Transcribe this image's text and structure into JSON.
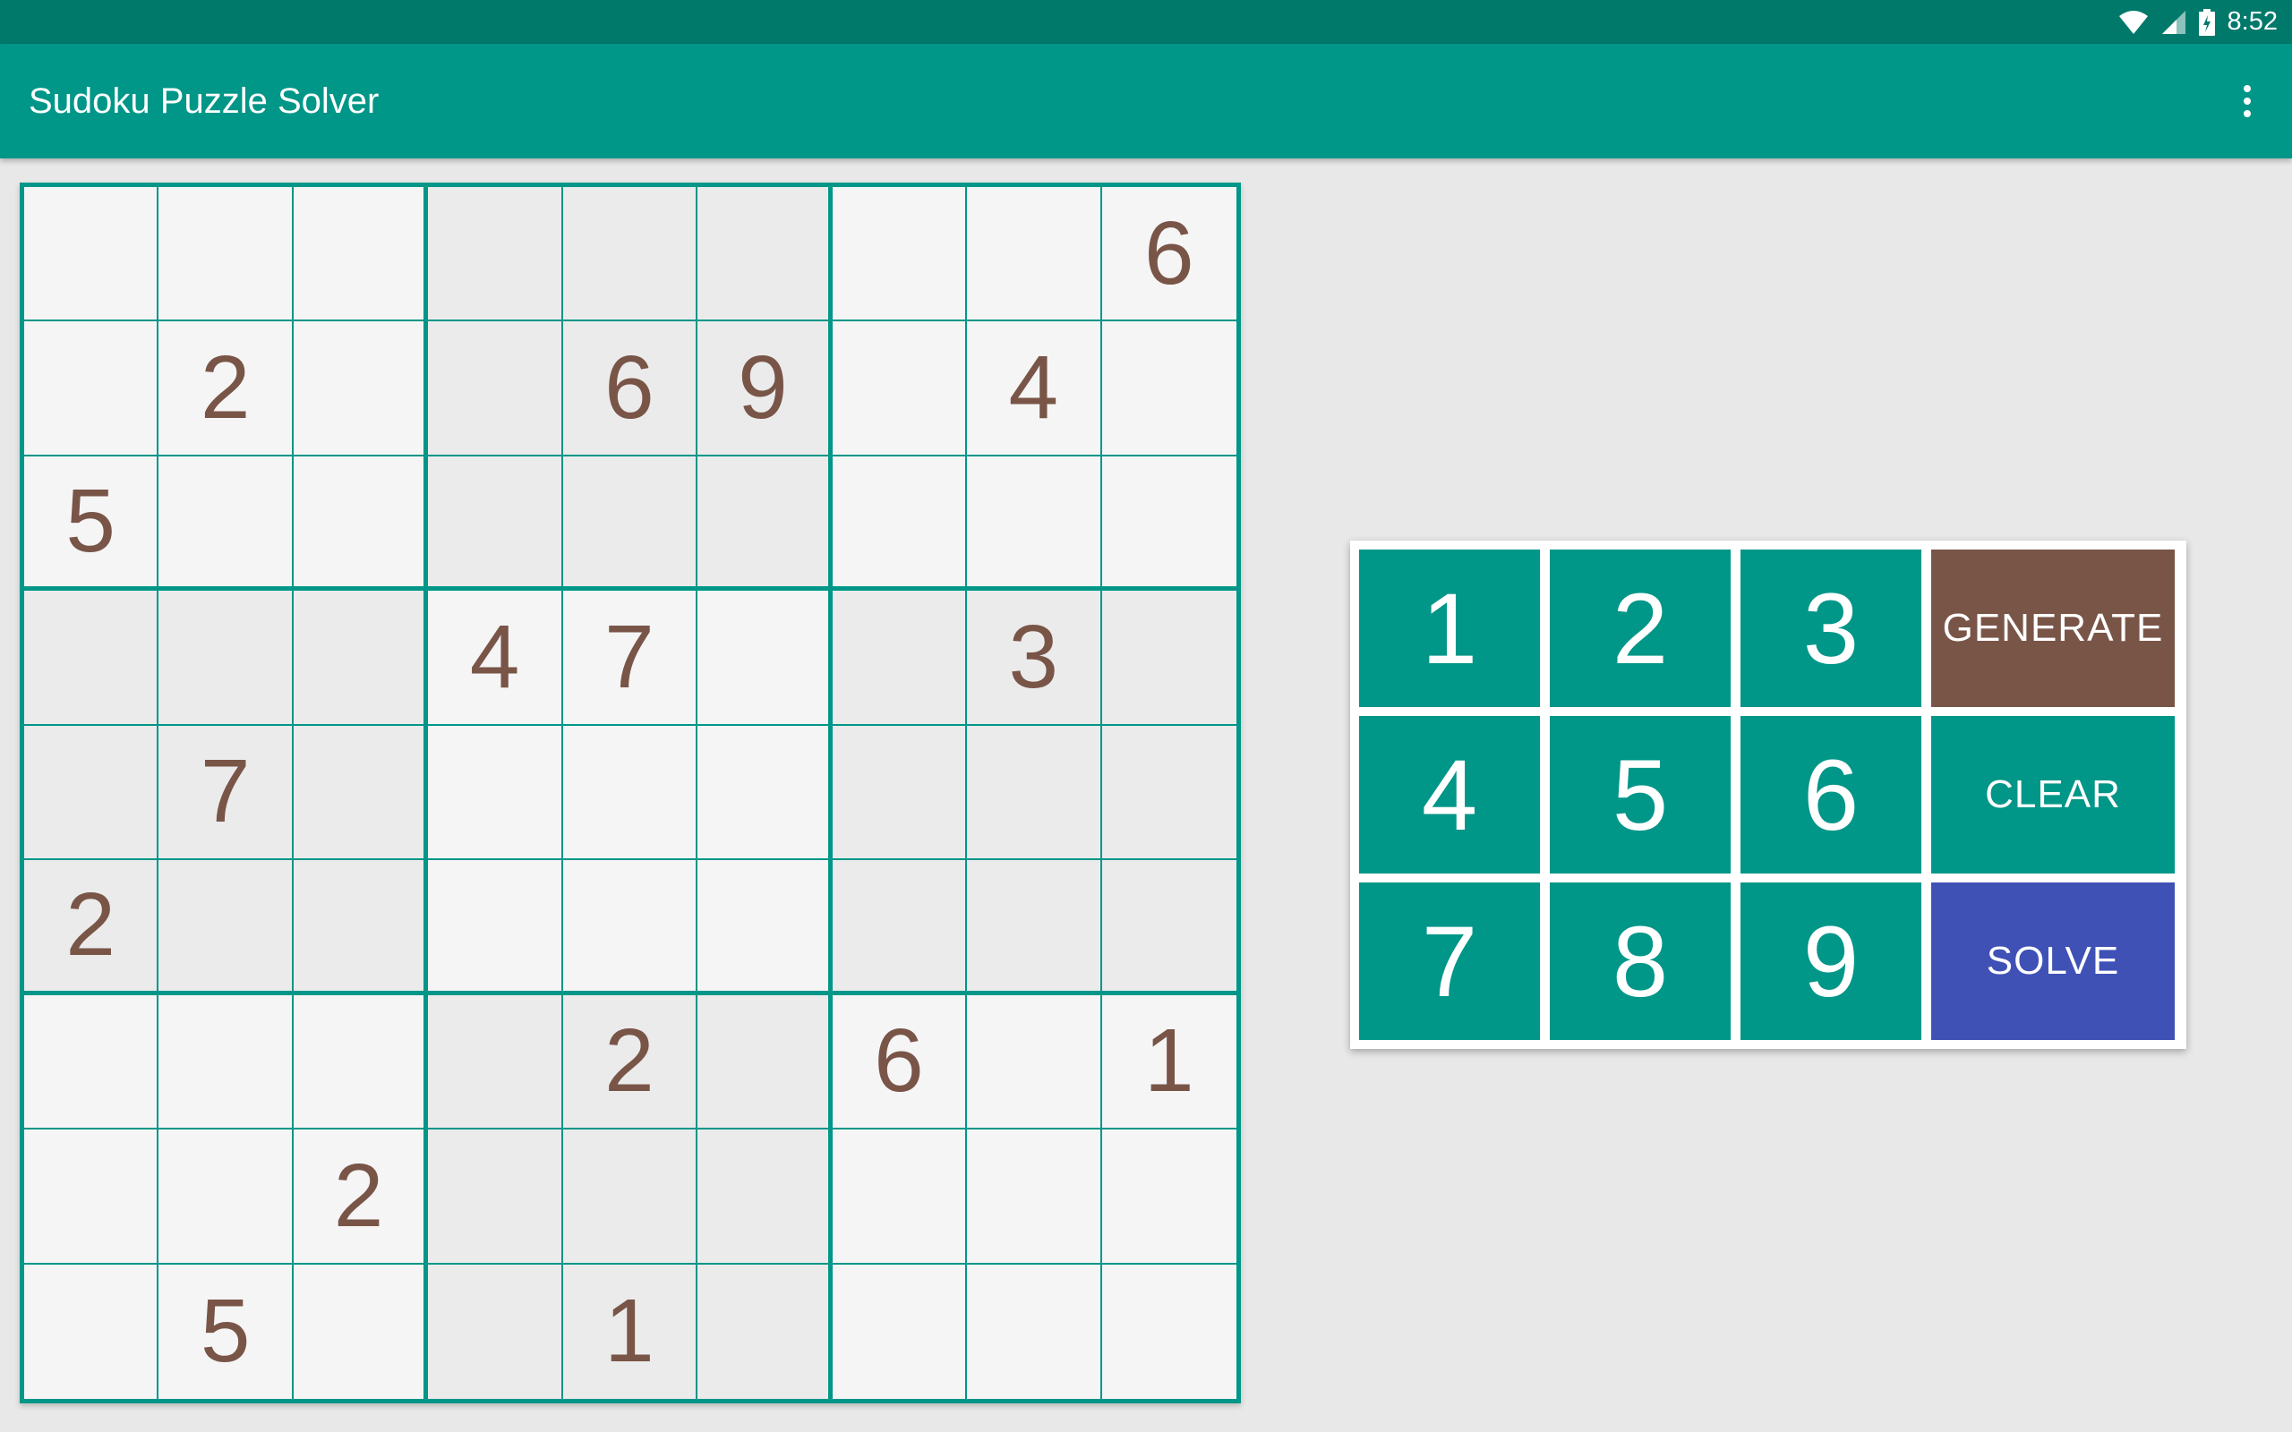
{
  "status_bar": {
    "time": "8:52",
    "icons": [
      "wifi-icon",
      "cell-signal-icon",
      "battery-charging-icon"
    ]
  },
  "app_bar": {
    "title": "Sudoku Puzzle Solver",
    "menu_icon": "overflow-menu-icon"
  },
  "board": {
    "rows": [
      [
        "",
        "",
        "",
        "",
        "",
        "",
        "",
        "",
        "6"
      ],
      [
        "",
        "2",
        "",
        "",
        "6",
        "9",
        "",
        "4",
        ""
      ],
      [
        "5",
        "",
        "",
        "",
        "",
        "",
        "",
        "",
        ""
      ],
      [
        "",
        "",
        "",
        "4",
        "7",
        "",
        "",
        "3",
        ""
      ],
      [
        "",
        "7",
        "",
        "",
        "",
        "",
        "",
        "",
        ""
      ],
      [
        "2",
        "",
        "",
        "",
        "",
        "",
        "",
        "",
        ""
      ],
      [
        "",
        "",
        "",
        "",
        "2",
        "",
        "6",
        "",
        "1"
      ],
      [
        "",
        "",
        "2",
        "",
        "",
        "",
        "",
        "",
        ""
      ],
      [
        "",
        "5",
        "",
        "",
        "1",
        "",
        "",
        "",
        ""
      ]
    ]
  },
  "keypad": {
    "numbers": [
      "1",
      "2",
      "3",
      "4",
      "5",
      "6",
      "7",
      "8",
      "9"
    ],
    "generate_label": "GENERATE",
    "clear_label": "CLEAR",
    "solve_label": "SOLVE"
  },
  "colors": {
    "status_bar": "#00796b",
    "app_bar": "#009688",
    "grid_lines": "#009688",
    "digit": "#795548",
    "generate_button": "#795548",
    "clear_button": "#009688",
    "solve_button": "#3f51b5"
  }
}
